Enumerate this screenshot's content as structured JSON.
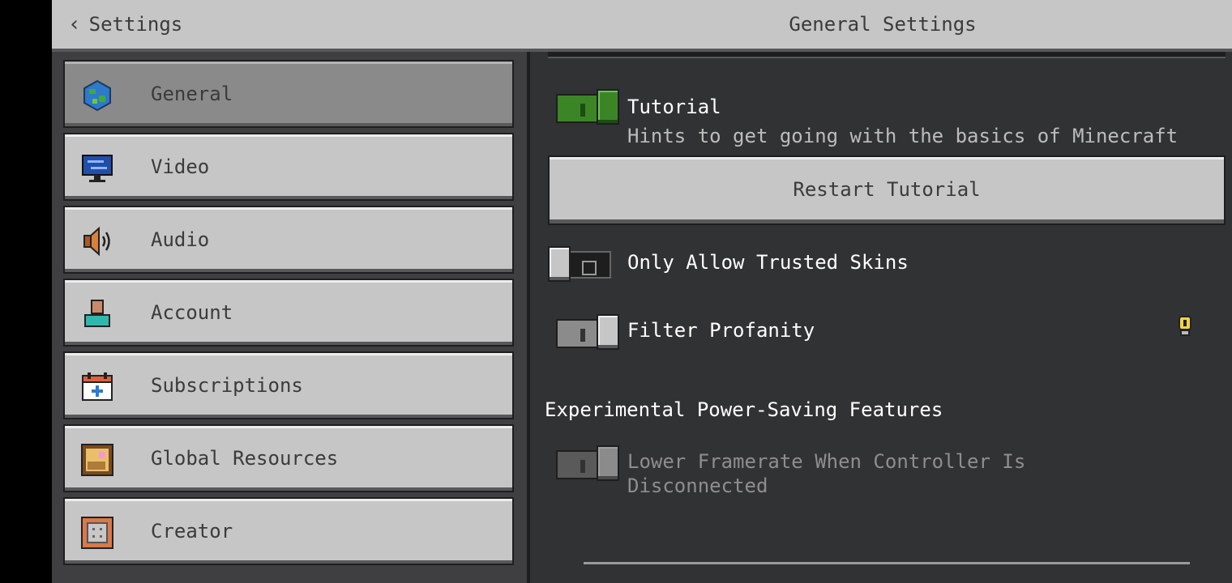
{
  "header": {
    "back_label": "Settings",
    "title": "General Settings"
  },
  "sidebar": {
    "items": [
      {
        "label": "General",
        "icon": "globe-icon",
        "active": true
      },
      {
        "label": "Video",
        "icon": "monitor-icon",
        "active": false
      },
      {
        "label": "Audio",
        "icon": "speaker-icon",
        "active": false
      },
      {
        "label": "Account",
        "icon": "person-icon",
        "active": false
      },
      {
        "label": "Subscriptions",
        "icon": "calendar-plus-icon",
        "active": false
      },
      {
        "label": "Global Resources",
        "icon": "painting-icon",
        "active": false
      },
      {
        "label": "Creator",
        "icon": "command-block-icon",
        "active": false
      }
    ]
  },
  "settings": {
    "tutorial": {
      "label": "Tutorial",
      "description": "Hints to get going with the basics of Minecraft",
      "enabled": true
    },
    "restart_tutorial_label": "Restart Tutorial",
    "trusted_skins": {
      "label": "Only Allow Trusted Skins",
      "enabled": false
    },
    "filter_profanity": {
      "label": "Filter Profanity",
      "enabled": false
    },
    "power_saving_heading": "Experimental Power-Saving Features",
    "lower_framerate": {
      "label_line1": "Lower Framerate When Controller Is",
      "label_line2": "Disconnected",
      "enabled": false,
      "disabled": true
    }
  },
  "colors": {
    "panel": "#c6c6c6",
    "background": "#313233",
    "toggle_on": "#3c8527"
  }
}
